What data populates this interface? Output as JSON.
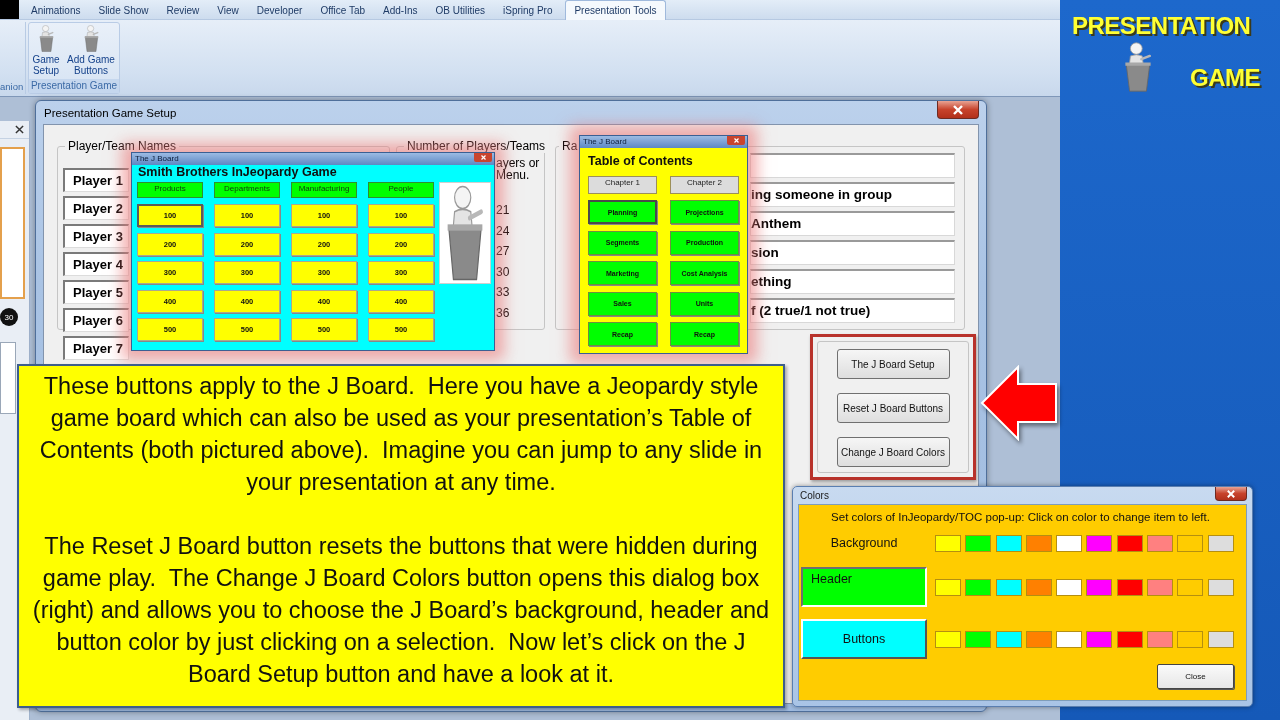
{
  "ribbon": {
    "tabs": [
      {
        "label": "Animations",
        "selected": false
      },
      {
        "label": "Slide Show",
        "selected": false
      },
      {
        "label": "Review",
        "selected": false
      },
      {
        "label": "View",
        "selected": false
      },
      {
        "label": "Developer",
        "selected": false
      },
      {
        "label": "Office Tab",
        "selected": false
      },
      {
        "label": "Add-Ins",
        "selected": false
      },
      {
        "label": "OB Utilities",
        "selected": false
      },
      {
        "label": "iSpring Pro",
        "selected": false
      },
      {
        "label": "Presentation Tools",
        "selected": true
      }
    ],
    "cut_group_label": "anion",
    "group": {
      "label": "Presentation Game",
      "buttons": [
        "Game Setup",
        "Add Game Buttons"
      ]
    }
  },
  "slides_pane": {
    "thumbnails": [
      {
        "selected": true
      },
      {
        "selected": false
      }
    ],
    "badge": "30"
  },
  "setup_dialog": {
    "title": "Presentation Game Setup",
    "player_group": {
      "label": "Player/Team Names",
      "players": [
        "Player 1",
        "Player 2",
        "Player 3",
        "Player 4",
        "Player 5",
        "Player 6",
        "Player 7"
      ]
    },
    "count_group": {
      "label": "Number of Players/Teams",
      "note_lines": [
        "ayers or",
        "Menu."
      ],
      "options": [
        "21",
        "24",
        "27",
        "30",
        "33",
        "36"
      ]
    },
    "third_group": {
      "label": "Ra",
      "fields": [
        {
          "kind": "empty"
        },
        {
          "kind": "text",
          "value": "ing someone in group"
        },
        {
          "kind": "text",
          "value": "Anthem"
        },
        {
          "kind": "text",
          "value": "sion"
        },
        {
          "kind": "text",
          "value": "ething"
        },
        {
          "kind": "text",
          "value": "f (2 true/1 not true)"
        }
      ]
    },
    "buttons": [
      "The J Board Setup",
      "Reset J Board Buttons",
      "Change J Board Colors"
    ]
  },
  "jboard_popup": {
    "window_title": "The J Board",
    "title": "Smith Brothers InJeopardy Game",
    "categories": [
      {
        "name": "Products",
        "cells": [
          {
            "label": "100",
            "focused": true
          },
          {
            "label": "200",
            "focused": false
          },
          {
            "label": "300",
            "focused": false
          },
          {
            "label": "400",
            "focused": false
          },
          {
            "label": "500",
            "focused": false
          }
        ]
      },
      {
        "name": "Departments",
        "cells": [
          {
            "label": "100",
            "focused": false
          },
          {
            "label": "200",
            "focused": false
          },
          {
            "label": "300",
            "focused": false
          },
          {
            "label": "400",
            "focused": false
          },
          {
            "label": "500",
            "focused": false
          }
        ]
      },
      {
        "name": "Manufacturing",
        "cells": [
          {
            "label": "100",
            "focused": false
          },
          {
            "label": "200",
            "focused": false
          },
          {
            "label": "300",
            "focused": false
          },
          {
            "label": "400",
            "focused": false
          },
          {
            "label": "500",
            "focused": false
          }
        ]
      },
      {
        "name": "People",
        "cells": [
          {
            "label": "100",
            "focused": false
          },
          {
            "label": "200",
            "focused": false
          },
          {
            "label": "300",
            "focused": false
          },
          {
            "label": "400",
            "focused": false
          },
          {
            "label": "500",
            "focused": false
          }
        ]
      }
    ]
  },
  "toc_popup": {
    "window_title": "The J Board",
    "title": "Table of Contents",
    "chapters": [
      {
        "name": "Chapter 1",
        "items": [
          {
            "label": "Planning",
            "focused": true
          },
          {
            "label": "Segments",
            "focused": false
          },
          {
            "label": "Marketing",
            "focused": false
          },
          {
            "label": "Sales",
            "focused": false
          },
          {
            "label": "Recap",
            "focused": false
          }
        ]
      },
      {
        "name": "Chapter 2",
        "items": [
          {
            "label": "Projections",
            "focused": false
          },
          {
            "label": "Production",
            "focused": false
          },
          {
            "label": "Cost Analysis",
            "focused": false
          },
          {
            "label": "Units",
            "focused": false
          },
          {
            "label": "Recap",
            "focused": false
          }
        ]
      }
    ]
  },
  "callout": {
    "paragraphs": [
      "These buttons apply to the J Board.  Here you have a Jeopardy style game board which can also be used as your presentation’s Table of Contents (both pictured above).  Imagine you can jump to any slide in your presentation at any time.",
      "The Reset J Board button resets the buttons that were hidden during game play.  The Change J Board Colors button opens this dialog box (right) and allows you to choose the J Board’s background, header and button color by just clicking on a selection.  Now let’s click on the J Board Setup button and have a look at it."
    ]
  },
  "colors_dialog": {
    "title": "Colors",
    "instruction": "Set colors of InJeopardy/TOC pop-up: Click on color to change item to left.",
    "rows": [
      {
        "kind": "label",
        "label": "Background",
        "swatches": [
          {
            "color": "#ffff00"
          },
          {
            "color": "#00ff00"
          },
          {
            "color": "#00ffff"
          },
          {
            "color": "#ff8000"
          },
          {
            "color": "#ffffff"
          },
          {
            "color": "#ff00ff"
          },
          {
            "color": "#ff0000"
          },
          {
            "color": "#ff8080"
          },
          {
            "color": "#ffcc00"
          },
          {
            "color": "#dddddd"
          }
        ]
      },
      {
        "kind": "field",
        "label": "Header",
        "color": "#00ff00",
        "swatches": [
          {
            "color": "#ffff00"
          },
          {
            "color": "#00ff00"
          },
          {
            "color": "#00ffff"
          },
          {
            "color": "#ff8000"
          },
          {
            "color": "#ffffff"
          },
          {
            "color": "#ff00ff"
          },
          {
            "color": "#ff0000"
          },
          {
            "color": "#ff8080"
          },
          {
            "color": "#ffcc00"
          },
          {
            "color": "#dddddd"
          }
        ]
      },
      {
        "kind": "button",
        "label": "Buttons",
        "color": "#00ffff",
        "swatches": [
          {
            "color": "#ffff00"
          },
          {
            "color": "#00ff00"
          },
          {
            "color": "#00ffff"
          },
          {
            "color": "#ff8000"
          },
          {
            "color": "#ffffff"
          },
          {
            "color": "#ff00ff"
          },
          {
            "color": "#ff0000"
          },
          {
            "color": "#ff8080"
          },
          {
            "color": "#ffcc00"
          },
          {
            "color": "#dddddd"
          }
        ]
      }
    ],
    "close_button": "Close"
  },
  "logo": {
    "lines": [
      "PRESENTATION",
      "GAME"
    ]
  }
}
